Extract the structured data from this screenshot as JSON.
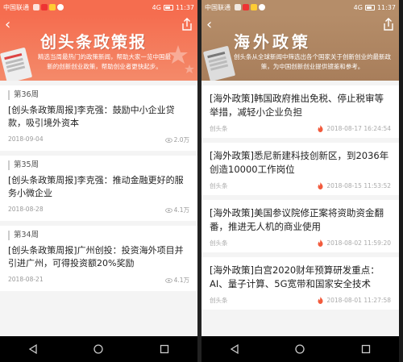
{
  "status": {
    "left": {
      "carrier": "中国联通",
      "signal": "4G",
      "battery": "",
      "time": "11:37"
    },
    "right": {
      "carrier": "中国联通",
      "signal": "4G",
      "battery": "",
      "time": "11:37"
    }
  },
  "left_screen": {
    "banner_title": "创头条政策报",
    "banner_desc": "精选当周最热门的政策新闻，帮助大家一览中国最新的创新创业政策，帮助创业者更快起步。",
    "items": [
      {
        "week": "第36周",
        "title": "[创头条政策周报]李克强：鼓励中小企业贷款，吸引境外资本",
        "date": "2018-09-04",
        "views": "2.0万"
      },
      {
        "week": "第35周",
        "title": "[创头条政策周报]李克强：推动金融更好的服务小微企业",
        "date": "2018-08-28",
        "views": "4.1万"
      },
      {
        "week": "第34周",
        "title": "[创头条政策周报]广州创投：投资海外项目并引进广州，可得投资额20%奖励",
        "date": "2018-08-21",
        "views": "4.1万"
      }
    ]
  },
  "right_screen": {
    "banner_title": "海外政策",
    "banner_desc": "创头条从全球新闻中筛选出各个国家关于创新创业的最新政策，为中国创新创业提供镜鉴和参考。",
    "items": [
      {
        "title": "[海外政策]韩国政府推出免税、停止税审等举措，减轻小企业负担",
        "source": "创头条",
        "datetime": "2018-08-17 16:24:54"
      },
      {
        "title": "[海外政策]悉尼新建科技创新区，到2036年创造10000工作岗位",
        "source": "创头条",
        "datetime": "2018-08-15 11:53:52"
      },
      {
        "title": "[海外政策]美国参议院修正案将资助资金翻番，推进无人机的商业使用",
        "source": "创头条",
        "datetime": "2018-08-02 11:59:20"
      },
      {
        "title": "[海外政策]白宫2020财年预算研发重点：AI、量子计算、5G宽带和国家安全技术",
        "source": "创头条",
        "datetime": "2018-08-01 11:27:58"
      }
    ]
  },
  "colors": {
    "left_accent": "#f56d4f",
    "right_accent": "#b58d69",
    "fire": "#f25a3c"
  },
  "icons": [
    "back-arrow-icon",
    "share-icon",
    "eye-icon",
    "fire-icon",
    "nav-back-icon",
    "nav-home-icon",
    "nav-recent-icon"
  ]
}
